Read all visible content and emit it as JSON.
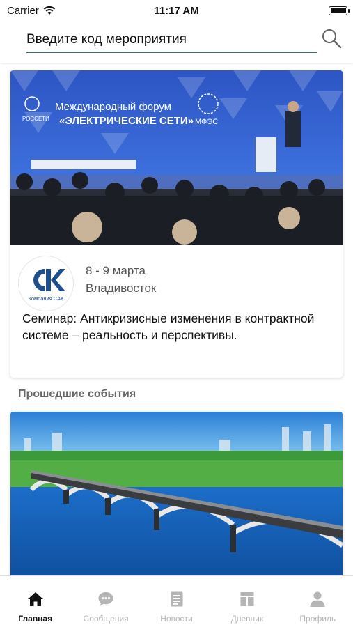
{
  "status_bar": {
    "carrier": "Carrier",
    "time": "11:17 AM"
  },
  "search": {
    "placeholder": "Введите код мероприятия"
  },
  "event": {
    "banner_line1": "Международный форум",
    "banner_line2": "«ЭЛЕКТРИЧЕСКИЕ СЕТИ»",
    "banner_logo_left": "РОССЕТИ",
    "banner_logo_right": "МФЭС",
    "org_logo_text": "Компания САК",
    "date": "8  - 9 марта",
    "city": "Владивосток",
    "title": "Семинар: Антикризисные изменения в контрактной системе – реальность и перспективы."
  },
  "past_section": {
    "title": "Прошедшие события"
  },
  "tabs": [
    {
      "label": "Главная",
      "icon": "home-icon",
      "active": true
    },
    {
      "label": "Сообщения",
      "icon": "chat-icon",
      "active": false
    },
    {
      "label": "Новости",
      "icon": "document-icon",
      "active": false
    },
    {
      "label": "Дневник",
      "icon": "grid-icon",
      "active": false
    },
    {
      "label": "Профиль",
      "icon": "user-icon",
      "active": false
    }
  ],
  "colors": {
    "accent": "#3b6e8f",
    "logo_blue": "#1f4e8c",
    "tab_active": "#111111",
    "tab_inactive": "#b5b5b5"
  }
}
